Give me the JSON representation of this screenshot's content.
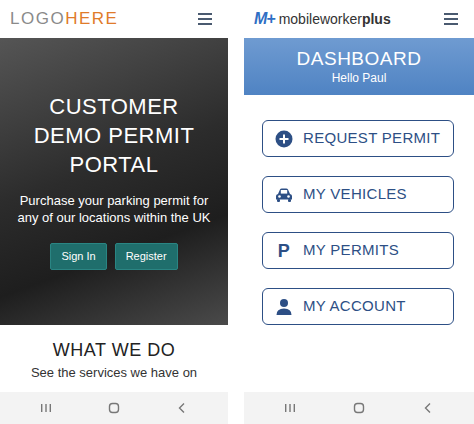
{
  "left_screen": {
    "logo": {
      "first": "LOGO",
      "second": "HERE"
    },
    "hero": {
      "title": "CUSTOMER DEMO PERMIT PORTAL",
      "subtitle": "Purchase your parking permit for any of our locations within the UK",
      "buttons": [
        "Sign In",
        "Register"
      ]
    },
    "section": {
      "title": "WHAT WE DO",
      "text": "See the services we have on"
    }
  },
  "right_screen": {
    "logo": {
      "mark": "M+",
      "first": "mobileworker",
      "second": "plus"
    },
    "dashboard": {
      "title": "DASHBOARD",
      "greeting": "Hello Paul"
    },
    "actions": [
      {
        "label": "REQUEST PERMIT",
        "kind": "request"
      },
      {
        "label": "MY VEHICLES",
        "kind": "vehicles"
      },
      {
        "label": "MY PERMITS",
        "kind": "permits",
        "glyph": "P"
      },
      {
        "label": "MY ACCOUNT",
        "kind": "account"
      }
    ]
  }
}
